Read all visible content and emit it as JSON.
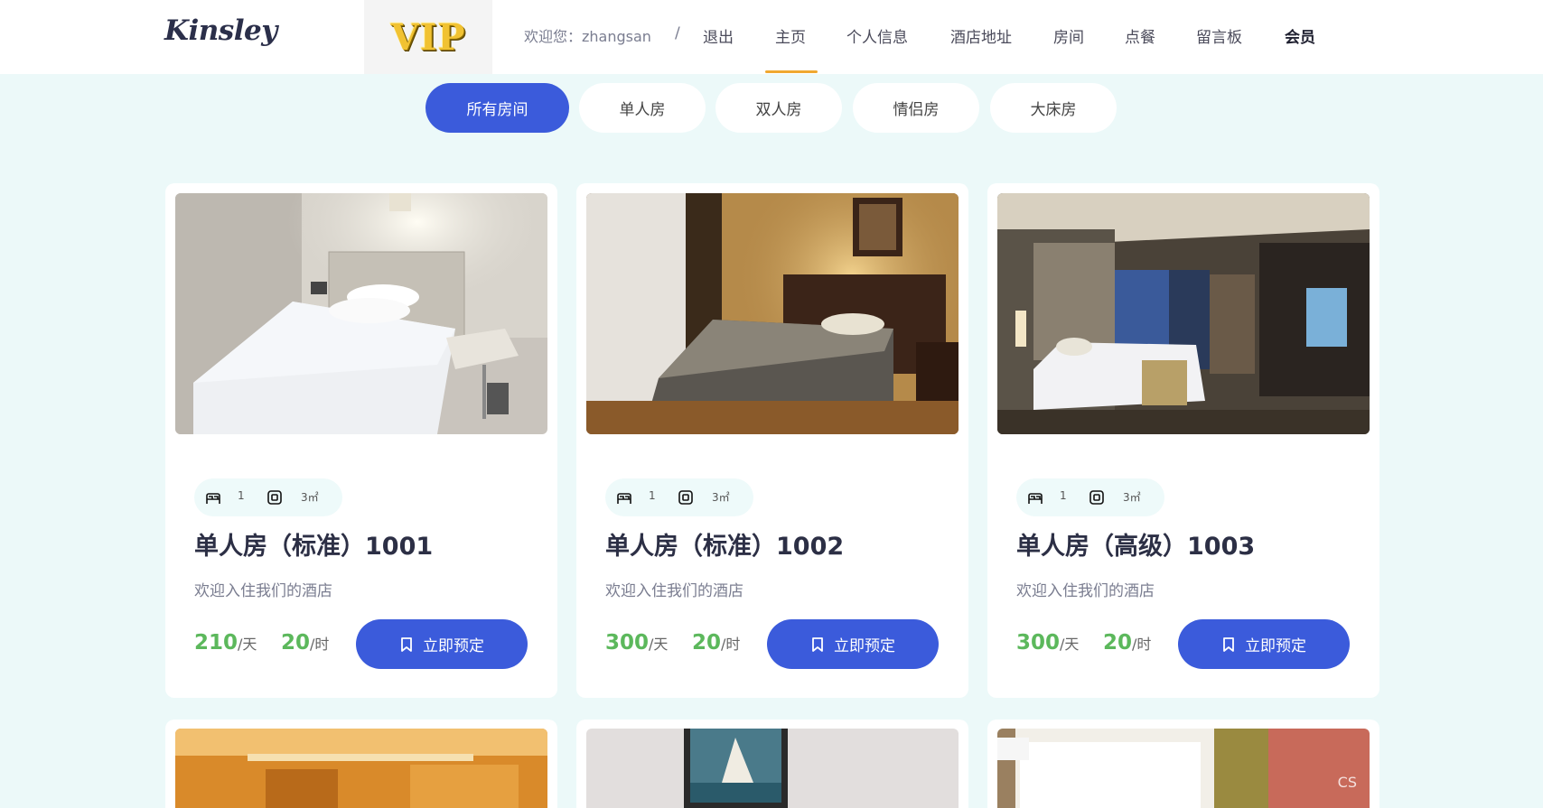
{
  "header": {
    "logo": "Kinsley",
    "vip_badge": "VIP",
    "welcome": "欢迎您：zhangsan",
    "separator": "/",
    "nav": [
      {
        "label": "退出"
      },
      {
        "label": "主页"
      },
      {
        "label": "个人信息"
      },
      {
        "label": "酒店地址"
      },
      {
        "label": "房间"
      },
      {
        "label": "点餐"
      },
      {
        "label": "留言板"
      },
      {
        "label": "会员"
      }
    ],
    "active_nav": "主页",
    "underline_color": "#f0a830"
  },
  "filters": {
    "tabs": [
      {
        "label": "所有房间"
      },
      {
        "label": "单人房"
      },
      {
        "label": "双人房"
      },
      {
        "label": "情侣房"
      },
      {
        "label": "大床房"
      }
    ],
    "active": "所有房间",
    "accent_color": "#3b5bdb"
  },
  "rooms": [
    {
      "beds": "1",
      "area": "3㎡",
      "title": "单人房（标准）1001",
      "desc": "欢迎入住我们的酒店",
      "price_day": "210",
      "day_unit": "/天",
      "price_hour": "20",
      "hour_unit": "/时",
      "book_label": "立即预定",
      "bed_icon": "bed-icon",
      "area_icon": "area-icon"
    },
    {
      "beds": "1",
      "area": "3㎡",
      "title": "单人房（标准）1002",
      "desc": "欢迎入住我们的酒店",
      "price_day": "300",
      "day_unit": "/天",
      "price_hour": "20",
      "hour_unit": "/时",
      "book_label": "立即预定",
      "bed_icon": "bed-icon",
      "area_icon": "area-icon"
    },
    {
      "beds": "1",
      "area": "3㎡",
      "title": "单人房（高级）1003",
      "desc": "欢迎入住我们的酒店",
      "price_day": "300",
      "day_unit": "/天",
      "price_hour": "20",
      "hour_unit": "/时",
      "book_label": "立即预定",
      "bed_icon": "bed-icon",
      "area_icon": "area-icon"
    }
  ],
  "watermark": "CS",
  "price_color": "#5cb85c",
  "button_color": "#3b5bdb"
}
